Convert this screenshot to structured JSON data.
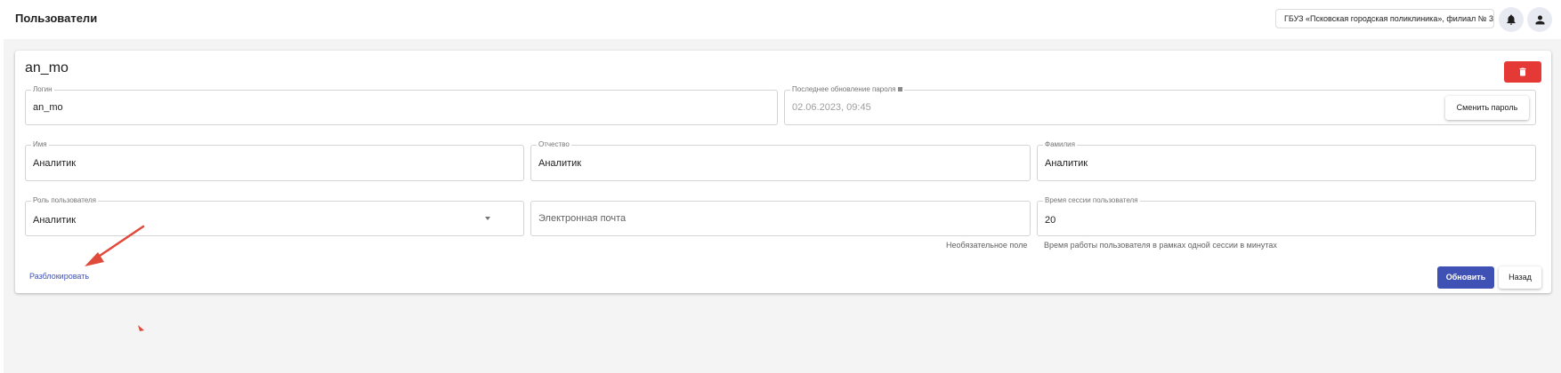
{
  "header": {
    "title": "Пользователи",
    "organization": "ГБУЗ «Псковская городская поликлиника», филиал № 3",
    "icons": [
      "bell-icon",
      "account-icon"
    ]
  },
  "card": {
    "title": "an_mo",
    "fields": {
      "login": {
        "label": "Логин",
        "value": "an_mo"
      },
      "password_updated": {
        "label": "Последнее обновление пароля",
        "value": "02.06.2023, 09:45"
      },
      "first_name": {
        "label": "Имя",
        "value": "Аналитик"
      },
      "patronymic": {
        "label": "Отчество",
        "value": "Аналитик"
      },
      "last_name": {
        "label": "Фамилия",
        "value": "Аналитик"
      },
      "role": {
        "label": "Роль пользователя",
        "value": "Аналитик"
      },
      "email": {
        "placeholder": "Электронная почта",
        "hint": "Необязательное поле"
      },
      "session_time": {
        "label": "Время сессии пользователя",
        "value": "20",
        "hint": "Время работы пользователя в рамках одной сессии в минутах"
      }
    },
    "buttons": {
      "change_password": "Сменить пароль",
      "unblock": "Разблокировать",
      "update": "Обновить",
      "back": "Назад",
      "delete_icon": "trash-icon"
    }
  },
  "colors": {
    "primary": "#3f51b5",
    "danger": "#e53935",
    "annotation": "#e04a3a",
    "background": "#f4f4f4"
  }
}
